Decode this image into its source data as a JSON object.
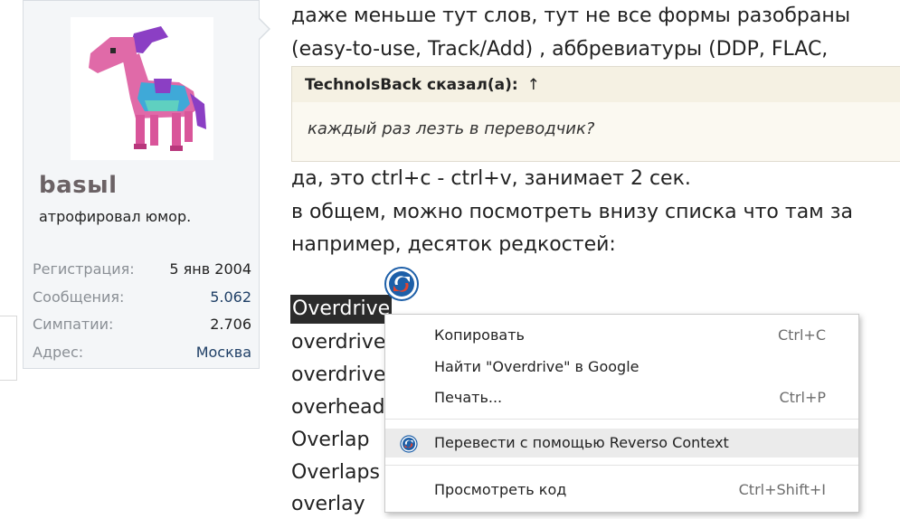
{
  "user": {
    "name": "basыl",
    "title": "атрофировал юмор.",
    "stats": [
      {
        "label": "Регистрация:",
        "value": "5 янв 2004"
      },
      {
        "label": "Сообщения:",
        "value": "5.062"
      },
      {
        "label": "Симпатии:",
        "value": "2.706"
      },
      {
        "label": "Адрес:",
        "value": "Москва"
      }
    ]
  },
  "post": {
    "line1": "даже меньше тут слов, тут не все формы разобраны",
    "line2": "(easy-to-use, Track/Add) , аббревиатуры (DDP, FLAC,",
    "quote_author": "TechnoIsBack сказал(а):",
    "quote_arrow": "↑",
    "quote_text": "каждый раз лезть в переводчик?",
    "line3": "да, это ctrl+c - ctrl+v, занимает 2 сек.",
    "line4": "в общем, можно посмотреть внизу списка что там за",
    "line5": "например, десяток редкостей:",
    "words": [
      "Overdrive",
      "overdrive",
      "overdrive",
      "overhead",
      "Overlap",
      "Overlaps",
      "overlay"
    ]
  },
  "context_menu": {
    "items": [
      {
        "label": "Копировать",
        "shortcut": "Ctrl+C"
      },
      {
        "label": "Найти \"Overdrive\" в Google",
        "shortcut": ""
      },
      {
        "label": "Печать...",
        "shortcut": "Ctrl+P"
      },
      {
        "label": "Перевести с помощью Reverso Context",
        "shortcut": "",
        "icon": "reverso-icon"
      },
      {
        "label": "Просмотреть код",
        "shortcut": "Ctrl+Shift+I"
      }
    ]
  },
  "colors": {
    "selection": "#2b2b2b",
    "card_bg": "#f4f6f8",
    "quote_bg": "#f5f1e3",
    "stat_value": "#1f3f66",
    "reverso_blue": "#1d5fa8",
    "reverso_red": "#e2442f"
  }
}
